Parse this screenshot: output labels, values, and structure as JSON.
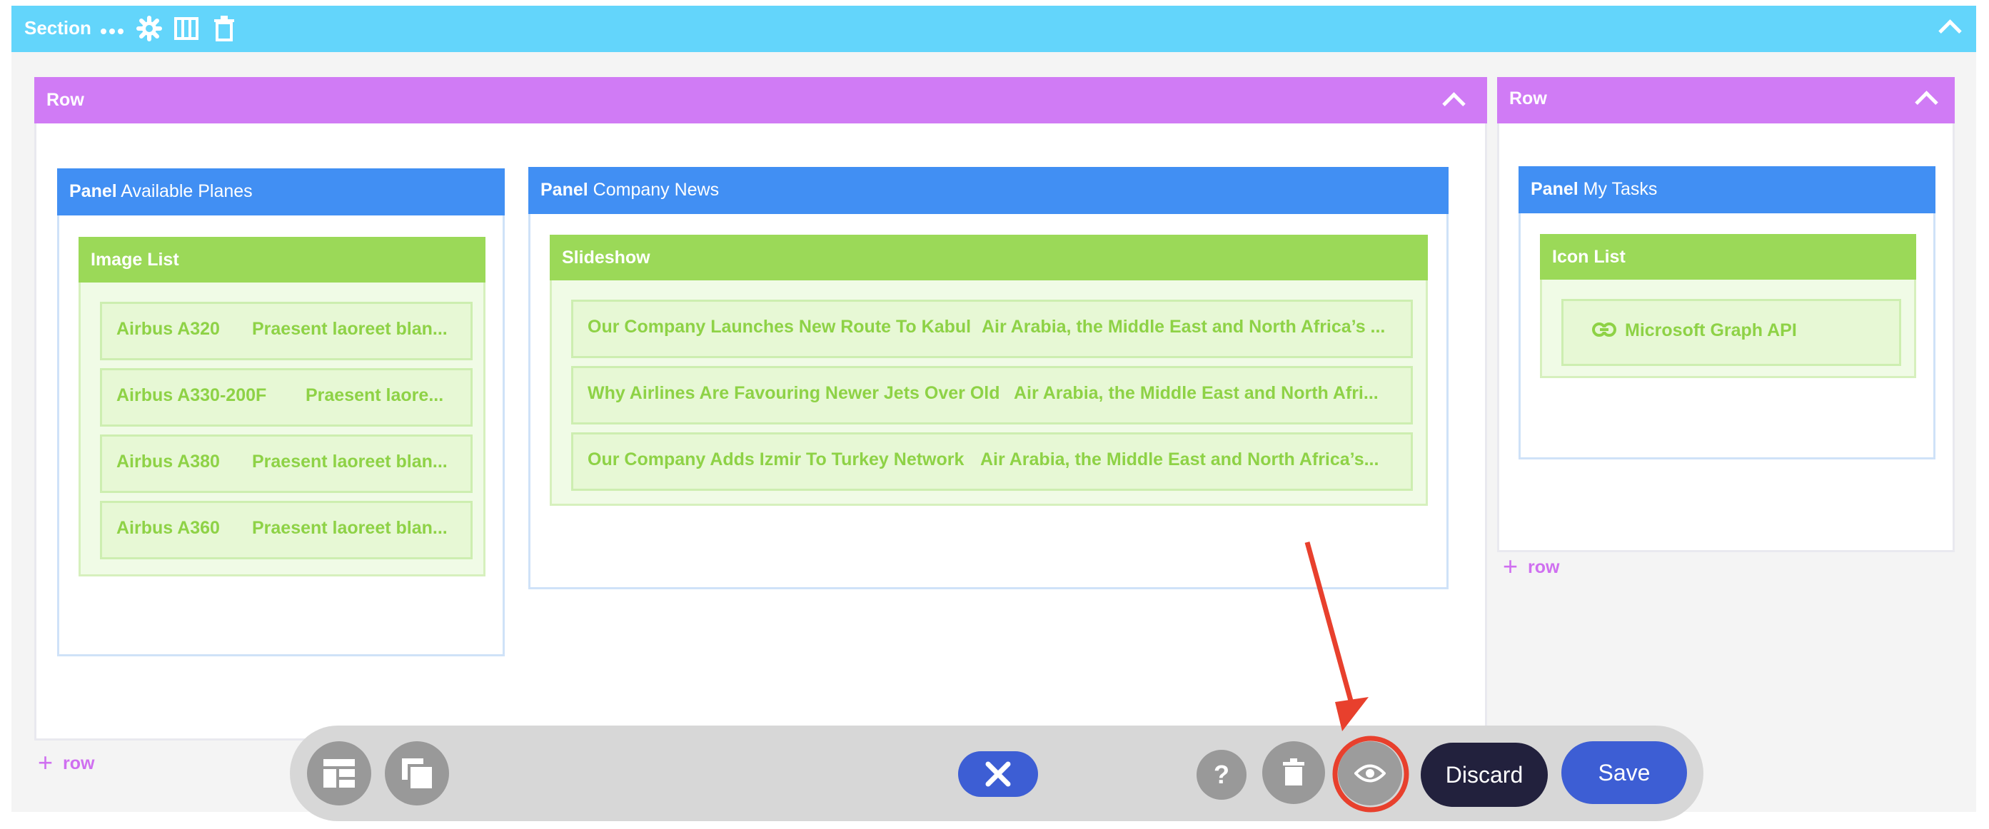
{
  "section": {
    "label": "Section",
    "icons": [
      "more-icon",
      "gear-icon",
      "columns-icon",
      "trash-icon",
      "chevron-up-icon"
    ]
  },
  "rows": [
    {
      "label": "Row",
      "add_row_label": "row",
      "panels": [
        {
          "label": "Panel",
          "title": "Available Planes",
          "widget": {
            "label": "Image List",
            "items": [
              {
                "name": "Airbus A320",
                "desc": "Praesent laoreet blan..."
              },
              {
                "name": "Airbus A330-200F",
                "desc": "Praesent laore..."
              },
              {
                "name": "Airbus A380",
                "desc": "Praesent laoreet blan..."
              },
              {
                "name": "Airbus A360",
                "desc": "Praesent laoreet blan..."
              }
            ]
          }
        },
        {
          "label": "Panel",
          "title": "Company News",
          "widget": {
            "label": "Slideshow",
            "items": [
              {
                "name": "Our Company Launches New Route To Kabul",
                "desc": "Air Arabia, the Middle East and North Africa’s ..."
              },
              {
                "name": "Why Airlines Are Favouring Newer Jets Over Old",
                "desc": "Air Arabia, the Middle East and North Afri..."
              },
              {
                "name": "Our Company Adds Izmir To Turkey Network",
                "desc": "Air Arabia, the Middle East and North Africa’s..."
              }
            ]
          }
        }
      ]
    },
    {
      "label": "Row",
      "add_row_label": "row",
      "panels": [
        {
          "label": "Panel",
          "title": "My Tasks",
          "widget": {
            "label": "Icon List",
            "items": [
              {
                "name": "Microsoft Graph API",
                "icon": "link-icon"
              }
            ]
          }
        }
      ]
    }
  ],
  "toolbar": {
    "discard_label": "Discard",
    "save_label": "Save",
    "help_glyph": "?",
    "icons": [
      "layout-icon",
      "copy-icon",
      "close-icon",
      "help-icon",
      "trash-icon",
      "eye-icon"
    ]
  },
  "colors": {
    "section": "#63d5fb",
    "row": "#d07bf5",
    "panel": "#418ff3",
    "widget": "#9bd958",
    "discard": "#22213d",
    "save": "#3d5ed4",
    "close": "#3d5ed4",
    "annotation": "#e8402d"
  }
}
